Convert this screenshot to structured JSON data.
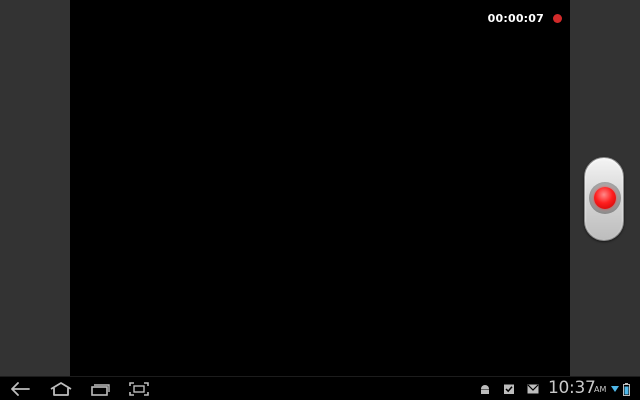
{
  "recording": {
    "elapsed": "00:00:07",
    "indicator_color": "#d22a2a",
    "indicator_icon": "recording-dot-icon"
  },
  "shutter": {
    "icon": "record-button-icon",
    "accent": "#ff1f1f"
  },
  "navbar": {
    "buttons": [
      "back-icon",
      "home-icon",
      "recent-apps-icon",
      "screenshot-icon"
    ],
    "notifications": [
      "android-debug-icon",
      "task-check-icon",
      "email-icon"
    ],
    "time": "10:37",
    "ampm": "AM",
    "status_icons": [
      "wifi-icon",
      "battery-icon"
    ]
  }
}
